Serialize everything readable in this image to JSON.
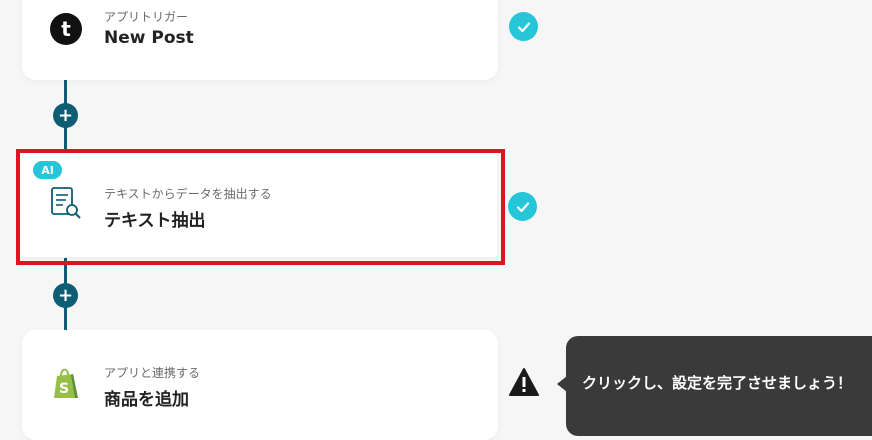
{
  "steps": [
    {
      "subtitle": "アプリトリガー",
      "title": "New Post",
      "icon": "tumblr-icon",
      "status": "complete"
    },
    {
      "badge": "AI",
      "subtitle": "テキストからデータを抽出する",
      "title": "テキスト抽出",
      "icon": "document-search-icon",
      "status": "complete",
      "highlighted": true
    },
    {
      "subtitle": "アプリと連携する",
      "title": "商品を追加",
      "icon": "shopify-icon",
      "status": "warning"
    }
  ],
  "add_step_symbol": "+",
  "tooltip": {
    "text": "クリックし、設定を完了させましょう！"
  },
  "colors": {
    "connector": "#0e5d74",
    "check": "#26c6d8",
    "highlight": "#e3101d",
    "tooltip_bg": "#3a3a3a",
    "shopify": "#95bf47"
  }
}
